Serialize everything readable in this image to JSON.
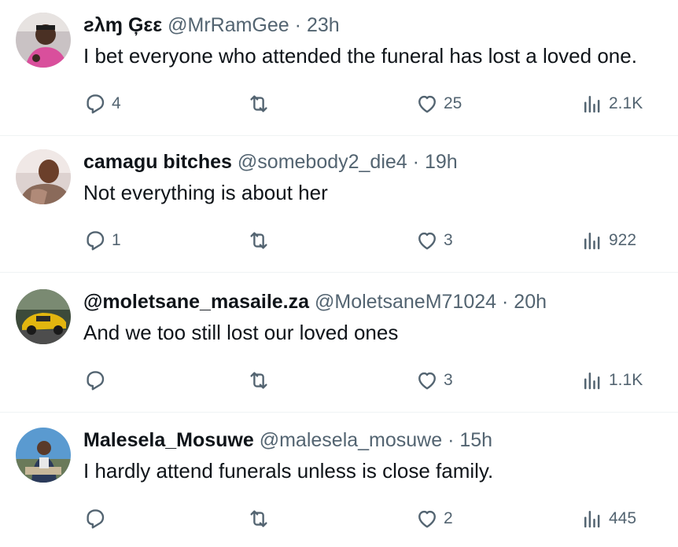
{
  "tweets": [
    {
      "name": "ƨλɱ Ģεε",
      "handle": "@MrRamGee",
      "separator": "·",
      "time": "23h",
      "text": "I bet everyone who attended the funeral has lost a loved one.",
      "replies": "4",
      "retweets": "",
      "likes": "25",
      "views": "2.1K"
    },
    {
      "name": "camagu bitches",
      "handle": "@somebody2_die4",
      "separator": "·",
      "time": "19h",
      "text": "Not everything is about her",
      "replies": "1",
      "retweets": "",
      "likes": "3",
      "views": "922"
    },
    {
      "name": "@moletsane_masaile.za",
      "handle": "@MoletsaneM71024",
      "separator": "·",
      "time": "20h",
      "text": "And we too still lost our loved ones",
      "replies": "",
      "retweets": "",
      "likes": "3",
      "views": "1.1K"
    },
    {
      "name": "Malesela_Mosuwe",
      "handle": "@malesela_mosuwe",
      "separator": "·",
      "time": "15h",
      "text": "I hardly attend funerals unless is close family.",
      "replies": "",
      "retweets": "",
      "likes": "2",
      "views": "445"
    }
  ],
  "icons": {
    "reply": "reply-icon",
    "retweet": "retweet-icon",
    "like": "heart-icon",
    "views": "views-icon"
  },
  "colors": {
    "text": "#0f1419",
    "secondary": "#536471",
    "divider": "#eff3f4"
  }
}
